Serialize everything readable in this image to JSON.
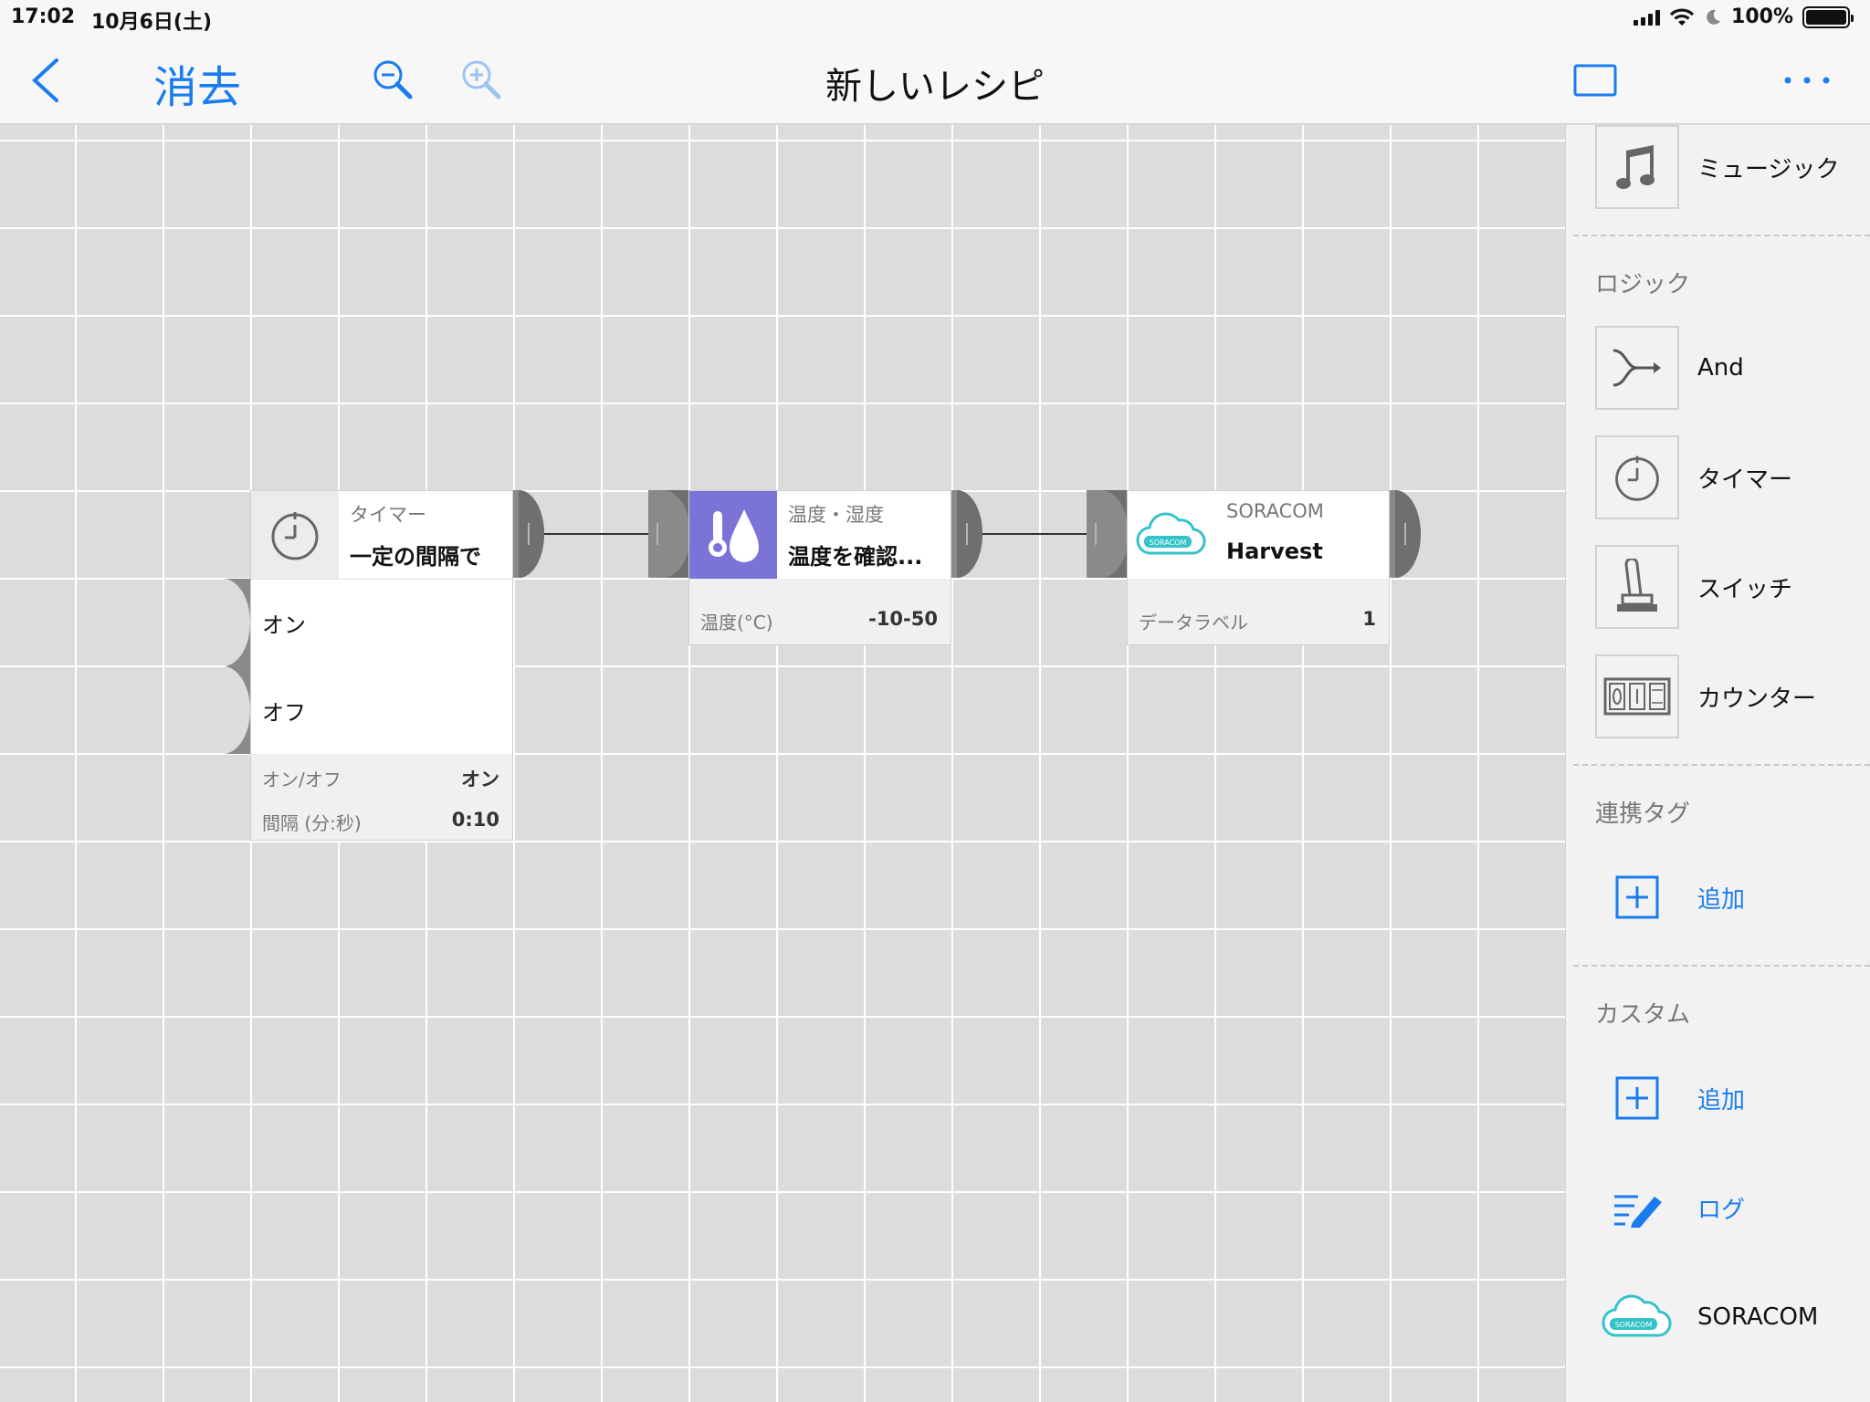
{
  "status": {
    "time": "17:02",
    "date": "10月6日(土)",
    "battery": "100%"
  },
  "nav": {
    "clear_label": "消去",
    "title": "新しいレシピ"
  },
  "nodes": {
    "timer": {
      "category": "タイマー",
      "title": "一定の間隔で",
      "ports": [
        "オン",
        "オフ"
      ],
      "props": [
        {
          "label": "オン/オフ",
          "value": "オン"
        },
        {
          "label": "間隔 (分:秒)",
          "value": "0:10"
        }
      ]
    },
    "temp": {
      "category": "温度・湿度",
      "title": "温度を確認...",
      "props": [
        {
          "label": "温度(°C)",
          "value": "-10-50"
        }
      ],
      "accent": "#7b74d6"
    },
    "harvest": {
      "category": "SORACOM",
      "title": "Harvest",
      "props": [
        {
          "label": "データラベル",
          "value": "1"
        }
      ]
    }
  },
  "sidebar": {
    "music": "ミュージック",
    "logic_header": "ロジック",
    "logic": [
      "And",
      "タイマー",
      "スイッチ",
      "カウンター"
    ],
    "tags_header": "連携タグ",
    "tags_add": "追加",
    "custom_header": "カスタム",
    "custom_add": "追加",
    "log": "ログ",
    "soracom": "SORACOM",
    "soracom_logo_text": "SORACOM"
  },
  "colors": {
    "accent_blue": "#1a7cf0",
    "soracom_teal": "#35c2c9",
    "connector_gray": "#8a8a8a"
  }
}
